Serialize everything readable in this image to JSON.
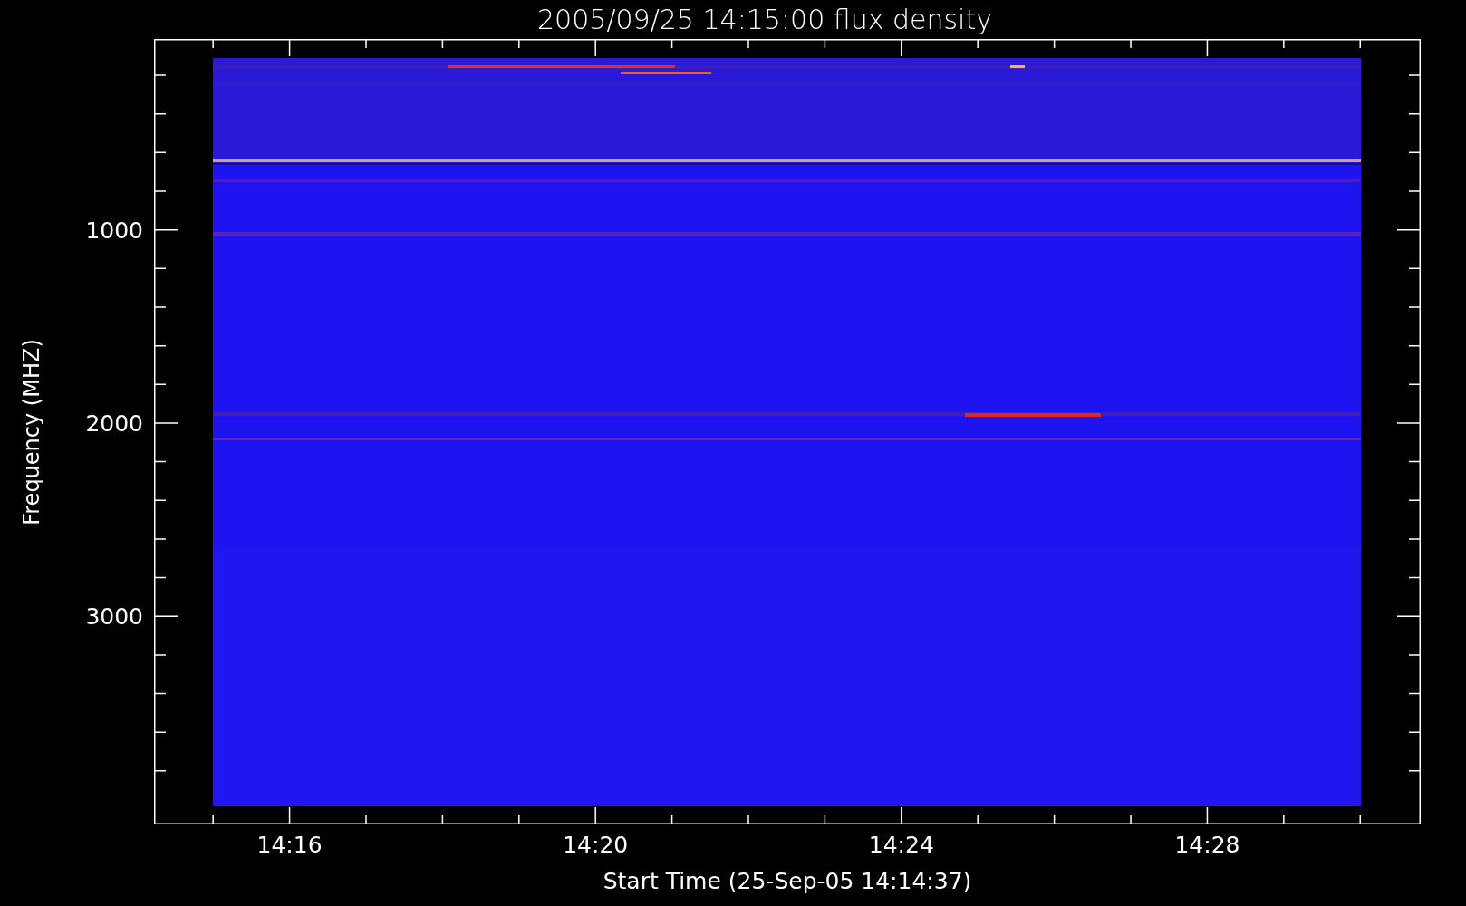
{
  "plot": {
    "title": "2005/09/25 14:15:00 flux density",
    "xlabel": "Start Time (25-Sep-05 14:14:37)",
    "ylabel": "Frequency (MHZ)",
    "xticks": [
      {
        "label": "14:16"
      },
      {
        "label": "14:20"
      },
      {
        "label": "14:24"
      },
      {
        "label": "14:28"
      }
    ],
    "yticks": [
      {
        "label": "1000"
      },
      {
        "label": "2000"
      },
      {
        "label": "3000"
      }
    ]
  }
}
